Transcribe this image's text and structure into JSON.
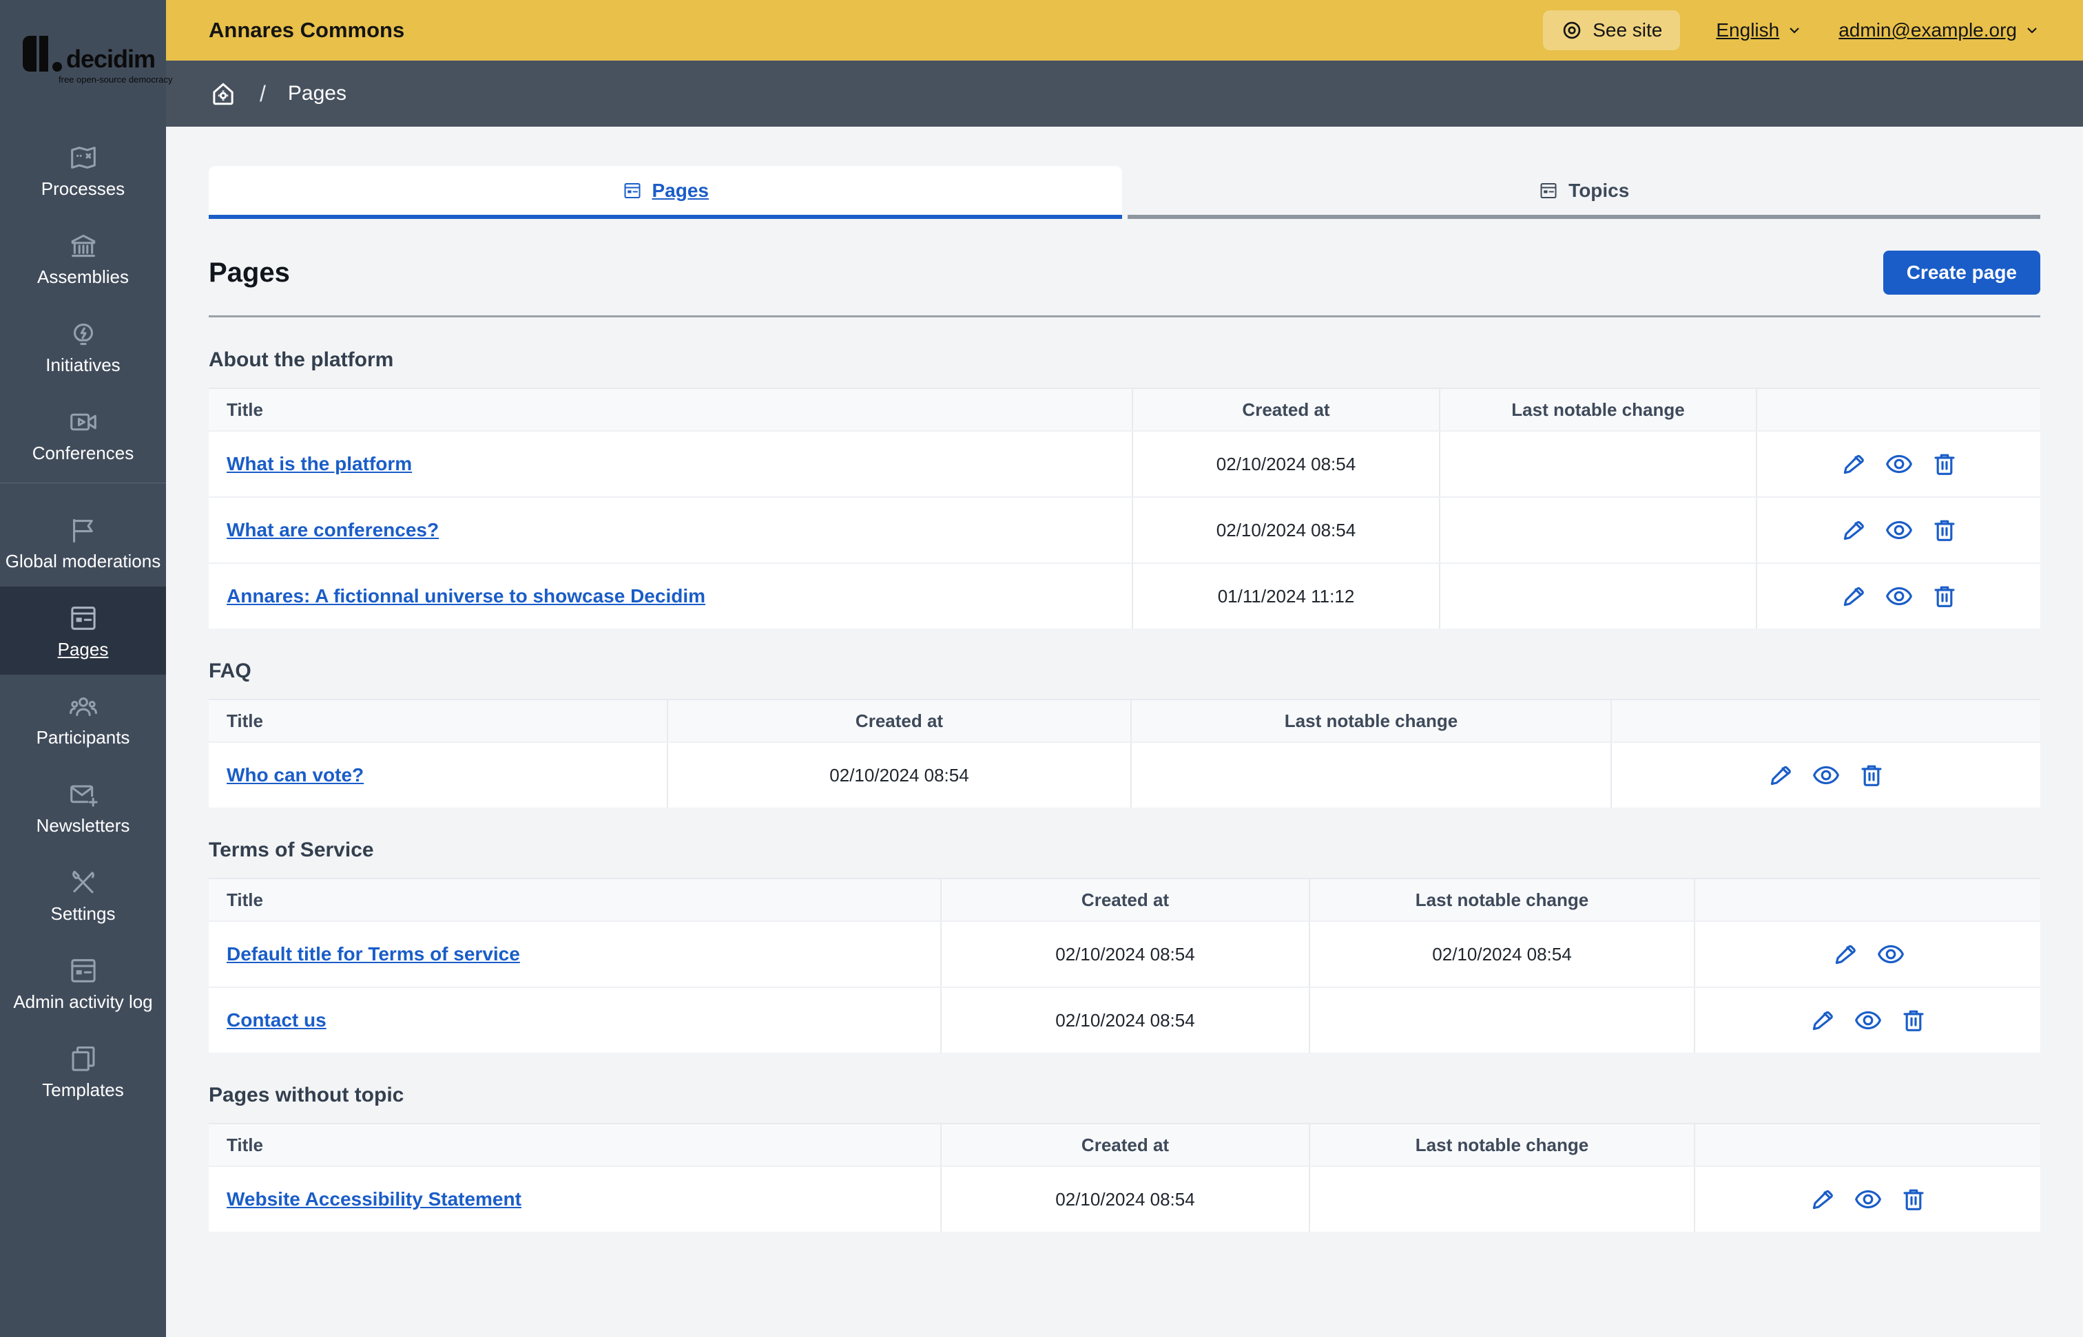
{
  "logo": {
    "name": "decidim",
    "tagline": "free open-source democracy"
  },
  "top_bar": {
    "site_name": "Annares Commons",
    "see_site_label": "See site",
    "see_site_icon": "concentric-eye-icon",
    "language_label": "English",
    "account_label": "admin@example.org"
  },
  "breadcrumb": {
    "home_icon": "home-gear-icon",
    "separator": "/",
    "current": "Pages"
  },
  "sidebar": {
    "items": [
      {
        "label": "Processes",
        "icon": "map-icon",
        "group": 1,
        "active": false
      },
      {
        "label": "Assemblies",
        "icon": "building-icon",
        "group": 1,
        "active": false
      },
      {
        "label": "Initiatives",
        "icon": "lightbulb-icon",
        "group": 1,
        "active": false
      },
      {
        "label": "Conferences",
        "icon": "video-camera-icon",
        "group": 1,
        "active": false
      },
      {
        "label": "Global moderations",
        "icon": "flag-icon",
        "group": 2,
        "active": false
      },
      {
        "label": "Pages",
        "icon": "article-icon",
        "group": 2,
        "active": true
      },
      {
        "label": "Participants",
        "icon": "people-icon",
        "group": 2,
        "active": false
      },
      {
        "label": "Newsletters",
        "icon": "mail-add-icon",
        "group": 2,
        "active": false
      },
      {
        "label": "Settings",
        "icon": "tools-icon",
        "group": 2,
        "active": false
      },
      {
        "label": "Admin activity log",
        "icon": "article-icon",
        "group": 2,
        "active": false
      },
      {
        "label": "Templates",
        "icon": "copy-icon",
        "group": 2,
        "active": false
      }
    ]
  },
  "tabs": [
    {
      "label": "Pages",
      "icon": "article-icon",
      "active": true
    },
    {
      "label": "Topics",
      "icon": "article-icon",
      "active": false
    }
  ],
  "page": {
    "title": "Pages",
    "create_button_label": "Create page"
  },
  "sections": [
    {
      "title": "About the platform",
      "columns": [
        "Title",
        "Created at",
        "Last notable change",
        ""
      ],
      "col_widths": "1342px 446px 460px 1fr",
      "rows": [
        {
          "title": "What is the platform",
          "created_at": "02/10/2024 08:54",
          "last_change": "",
          "actions": [
            "edit",
            "preview",
            "delete"
          ]
        },
        {
          "title": "What are conferences?",
          "created_at": "02/10/2024 08:54",
          "last_change": "",
          "actions": [
            "edit",
            "preview",
            "delete"
          ]
        },
        {
          "title": "Annares: A fictionnal universe to showcase Decidim",
          "created_at": "01/11/2024 11:12",
          "last_change": "",
          "actions": [
            "edit",
            "preview",
            "delete"
          ]
        }
      ]
    },
    {
      "title": "FAQ",
      "columns": [
        "Title",
        "Created at",
        "Last notable change",
        ""
      ],
      "col_widths": "667px 673px 697px 1fr",
      "rows": [
        {
          "title": "Who can vote?",
          "created_at": "02/10/2024 08:54",
          "last_change": "",
          "actions": [
            "edit",
            "preview",
            "delete"
          ]
        }
      ]
    },
    {
      "title": "Terms of Service",
      "columns": [
        "Title",
        "Created at",
        "Last notable change",
        ""
      ],
      "col_widths": "1064px 535px 559px 1fr",
      "rows": [
        {
          "title": "Default title for Terms of service",
          "created_at": "02/10/2024 08:54",
          "last_change": "02/10/2024 08:54",
          "actions": [
            "edit",
            "preview"
          ]
        },
        {
          "title": "Contact us",
          "created_at": "02/10/2024 08:54",
          "last_change": "",
          "actions": [
            "edit",
            "preview",
            "delete"
          ]
        }
      ]
    },
    {
      "title": "Pages without topic",
      "columns": [
        "Title",
        "Created at",
        "Last notable change",
        ""
      ],
      "col_widths": "1064px 535px 559px 1fr",
      "rows": [
        {
          "title": "Website Accessibility Statement",
          "created_at": "02/10/2024 08:54",
          "last_change": "",
          "actions": [
            "edit",
            "preview",
            "delete"
          ]
        }
      ]
    }
  ],
  "action_icons": {
    "edit": "pencil-icon",
    "preview": "eye-icon",
    "delete": "trash-icon"
  },
  "colors": {
    "accent_blue": "#1a5dc8",
    "top_bar_yellow": "#e8c04a",
    "sidebar_dark": "#414c5b",
    "breadcrumb_dark": "#48525f",
    "page_background": "#f3f4f6",
    "inactive_tab_border": "#8d959f"
  }
}
